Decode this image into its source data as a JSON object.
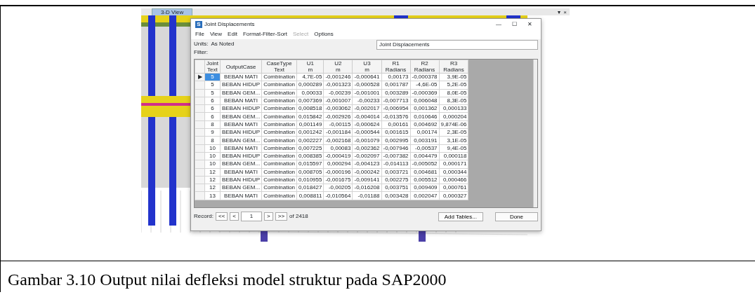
{
  "figure": {
    "screenshot": {
      "tab": {
        "label": "3-D View",
        "selected": true
      },
      "window_controls": [
        "▾",
        "×"
      ],
      "dialog": {
        "title": "Joint Displacements",
        "icon_letter": "S",
        "controls": [
          "—",
          "☐",
          "✕"
        ],
        "menu": [
          {
            "label": "File",
            "disabled": false
          },
          {
            "label": "View",
            "disabled": false
          },
          {
            "label": "Edit",
            "disabled": false
          },
          {
            "label": "Format-Filter-Sort",
            "disabled": false
          },
          {
            "label": "Select",
            "disabled": true
          },
          {
            "label": "Options",
            "disabled": false
          }
        ],
        "units_label": "Units:",
        "units_value": "As Noted",
        "filter_label": "Filter:",
        "table_selector": "Joint Displacements",
        "table": {
          "columns": [
            {
              "title": "Joint",
              "unit": "Text"
            },
            {
              "title": "OutputCase"
            },
            {
              "title": "CaseType",
              "unit": "Text"
            },
            {
              "title": "U1",
              "unit": "m"
            },
            {
              "title": "U2",
              "unit": "m"
            },
            {
              "title": "U3",
              "unit": "m"
            },
            {
              "title": "R1",
              "unit": "Radians"
            },
            {
              "title": "R2",
              "unit": "Radians"
            },
            {
              "title": "R3",
              "unit": "Radians"
            }
          ],
          "current_marker": "▶",
          "rows": [
            {
              "selected": true,
              "cells": [
                "5",
                "BEBAN MATI",
                "Combination",
                "4,7E-05",
                "-0,001246",
                "-0,000641",
                "0,00173",
                "-0,000378",
                "3,9E-05"
              ]
            },
            {
              "selected": false,
              "cells": [
                "5",
                "BEBAN HIDUP",
                "Combination",
                "0,000289",
                "-0,001323",
                "-0,000528",
                "0,001787",
                "-4,6E-05",
                "5,2E-05"
              ]
            },
            {
              "selected": false,
              "cells": [
                "5",
                "BEBAN GEM...",
                "Combination",
                "0,00033",
                "-0,00239",
                "-0,001001",
                "0,003289",
                "-0,000369",
                "8,0E-05"
              ]
            },
            {
              "selected": false,
              "cells": [
                "6",
                "BEBAN MATI",
                "Combination",
                "0,007369",
                "-0,001007",
                "-0,00233",
                "-0,007713",
                "0,006048",
                "8,3E-05"
              ]
            },
            {
              "selected": false,
              "cells": [
                "6",
                "BEBAN HIDUP",
                "Combination",
                "0,008518",
                "-0,003062",
                "-0,002017",
                "-0,006954",
                "0,001362",
                "0,000133"
              ]
            },
            {
              "selected": false,
              "cells": [
                "6",
                "BEBAN GEM...",
                "Combination",
                "0,015842",
                "-0,002926",
                "-0,004014",
                "-0,013576",
                "0,010646",
                "0,000204"
              ]
            },
            {
              "selected": false,
              "cells": [
                "8",
                "BEBAN MATI",
                "Combination",
                "0,001149",
                "-0,00115",
                "-0,000624",
                "0,00161",
                "0,004692",
                "9,874E-06"
              ]
            },
            {
              "selected": false,
              "cells": [
                "9",
                "BEBAN HIDUP",
                "Combination",
                "0,001242",
                "-0,001184",
                "-0,000544",
                "0,001615",
                "0,00174",
                "2,3E-05"
              ]
            },
            {
              "selected": false,
              "cells": [
                "8",
                "BEBAN GEM...",
                "Combination",
                "0,002227",
                "-0,002168",
                "-0,001079",
                "0,002995",
                "0,003191",
                "3,1E-05"
              ]
            },
            {
              "selected": false,
              "cells": [
                "10",
                "BEBAN MATI",
                "Combination",
                "0,007225",
                "0,00083",
                "-0,002362",
                "-0,007946",
                "-0,00537",
                "9,4E-05"
              ]
            },
            {
              "selected": false,
              "cells": [
                "10",
                "BEBAN HIDUP",
                "Combination",
                "0,008385",
                "-0,000419",
                "-0,002097",
                "-0,007382",
                "0,004479",
                "0,000118"
              ]
            },
            {
              "selected": false,
              "cells": [
                "10",
                "BEBAN GEM...",
                "Combination",
                "0,015597",
                "0,000294",
                "-0,004123",
                "-0,014113",
                "-0,005052",
                "0,000171"
              ]
            },
            {
              "selected": false,
              "cells": [
                "12",
                "BEBAN MATI",
                "Combination",
                "0,008705",
                "-0,000196",
                "-0,000242",
                "0,003721",
                "0,004681",
                "0,000344"
              ]
            },
            {
              "selected": false,
              "cells": [
                "12",
                "BEBAN HIDUP",
                "Combination",
                "0,010955",
                "-0,001675",
                "-0,009141",
                "0,002275",
                "0,005512",
                "0,000466"
              ]
            },
            {
              "selected": false,
              "cells": [
                "12",
                "BEBAN GEM...",
                "Combination",
                "0,018427",
                "-0,00205",
                "-0,016208",
                "0,003751",
                "0,009409",
                "0,000761"
              ]
            },
            {
              "selected": false,
              "cells": [
                "13",
                "BEBAN MATI",
                "Combination",
                "0,008811",
                "-0,010564",
                "-0,01188",
                "0,003428",
                "0,002047",
                "0,000327"
              ]
            }
          ]
        },
        "record": {
          "label": "Record:",
          "first": "<<",
          "prev": "<",
          "current": "1",
          "next": ">",
          "last": ">>",
          "total": "of 2418"
        },
        "buttons": [
          "Add Tables...",
          "Done"
        ]
      }
    },
    "caption": "Gambar 3.10 Output nilai defleksi model struktur pada SAP2000"
  }
}
